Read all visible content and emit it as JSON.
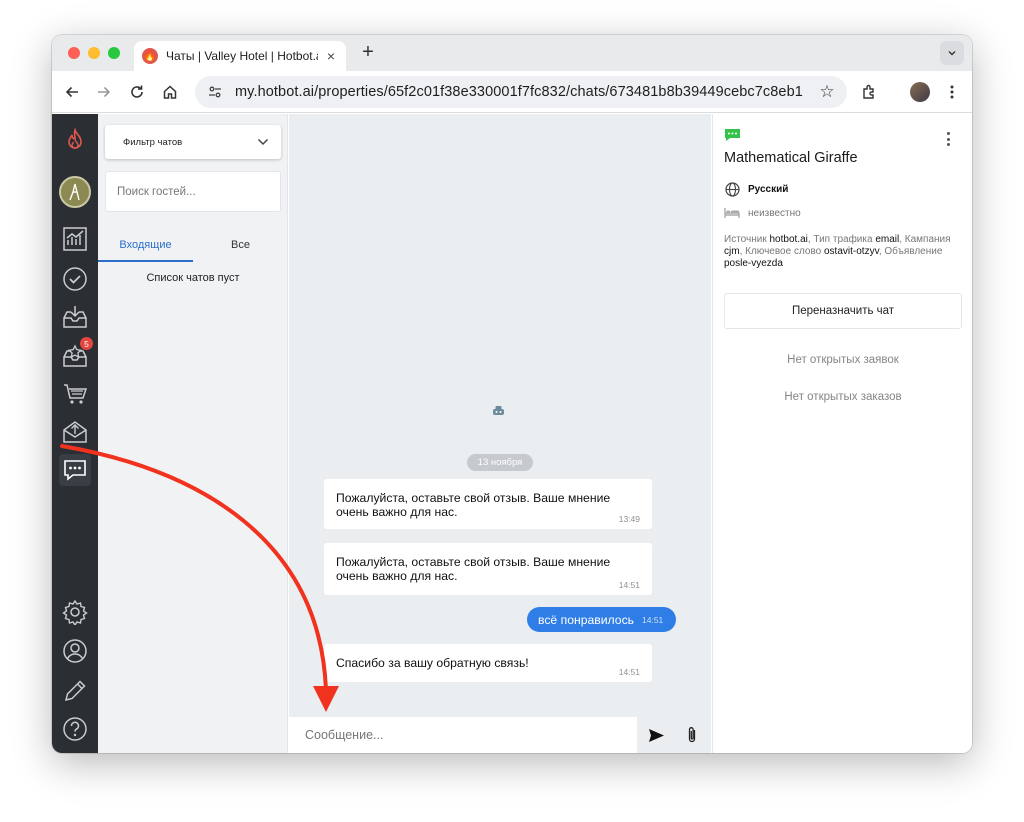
{
  "browser": {
    "tab_title": "Чаты | Valley Hotel | Hotbot.ai",
    "tab_close": "×",
    "new_tab": "+",
    "url": "my.hotbot.ai/properties/65f2c01f38e330001f7fc832/chats/673481b8b39449cebc7c8eb1"
  },
  "rail": {
    "badge_count": "5"
  },
  "chat_list": {
    "filter_label": "Фильтр чатов",
    "search_placeholder": "Поиск гостей...",
    "tabs": [
      {
        "label": "Входящие"
      },
      {
        "label": "Все"
      }
    ],
    "empty_text": "Список чатов пуст"
  },
  "conversation": {
    "date": "13 ноября",
    "messages": [
      {
        "text": "Пожалуйста, оставьте свой отзыв. Ваше мнение очень важно для нас.",
        "time": "13:49"
      },
      {
        "text": "Пожалуйста, оставьте свой отзыв. Ваше мнение очень важно для нас.",
        "time": "14:51"
      },
      {
        "text": "всё понравилось",
        "time": "14:51"
      },
      {
        "text": "Спасибо за вашу обратную связь!",
        "time": "14:51"
      }
    ],
    "composer_placeholder": "Сообщение..."
  },
  "details": {
    "guest_name": "Mathematical Giraffe",
    "language": "Русский",
    "room": "неизвестно",
    "source": {
      "source_label": "Источник",
      "source_value": "hotbot.ai",
      "traffic_label": "Тип трафика",
      "traffic_value": "email",
      "campaign_label": "Кампания",
      "campaign_value": "cjm",
      "keyword_label": "Ключевое слово",
      "keyword_value": "ostavit-otzyv",
      "ad_label": "Объявление",
      "ad_value": "posle-vyezda"
    },
    "reassign_label": "Переназначить чат",
    "no_requests": "Нет открытых заявок",
    "no_orders": "Нет открытых заказов"
  },
  "colors": {
    "accent": "#2f7ee7",
    "rail": "#2b2f34",
    "annotation_arrow": "#f0321e",
    "channel_green": "#35c24a"
  }
}
